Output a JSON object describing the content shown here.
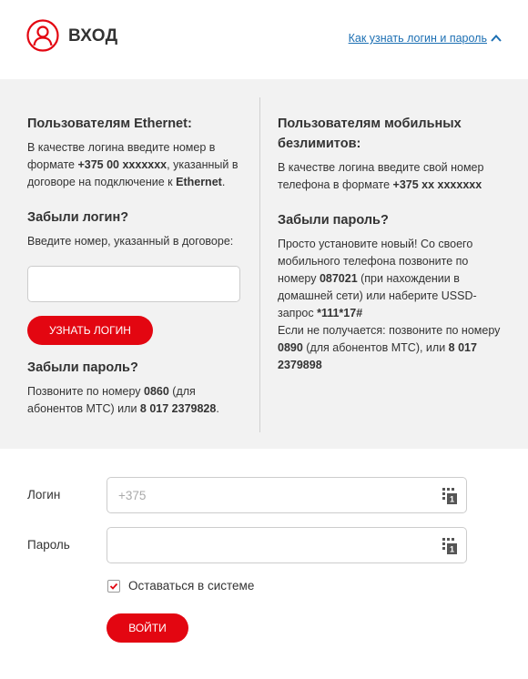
{
  "header": {
    "title": "ВХОД",
    "help_link": "Как узнать логин и пароль"
  },
  "info": {
    "ethernet": {
      "heading": "Пользователям Ethernet:",
      "text_1": "В качестве логина введите номер в формате ",
      "text_bold_1": "+375 00 xxxxxxx",
      "text_2": ", указанный в договоре на подключение к ",
      "text_bold_2": "Ethernet",
      "text_3": "."
    },
    "forgot_login": {
      "heading": "Забыли логин?",
      "text": "Введите номер, указанный в договоре:",
      "button": "Узнать логин"
    },
    "forgot_password_ethernet": {
      "heading": "Забыли пароль?",
      "text_1": "Позвоните по номеру ",
      "phone_1": "0860",
      "text_2": " (для абонентов МТС) или ",
      "phone_2": "8 017 2379828",
      "text_3": "."
    },
    "mobile": {
      "heading": "Пользователям мобильных безлимитов:",
      "text_1": "В качестве логина введите свой номер телефона в формате ",
      "text_bold": "+375 xx xxxxxxx"
    },
    "forgot_password_mobile": {
      "heading": "Забыли пароль?",
      "text_1": "Просто установите новый! Со своего мобильного телефона позвоните по номеру ",
      "phone_1": "087021",
      "text_2": " (при нахождении в домашней сети) или наберите USSD-запрос ",
      "ussd": "*111*17#",
      "text_3": "Если не получается: позвоните по номеру ",
      "phone_2": "0890",
      "text_4": " (для абонентов МТС), или ",
      "phone_3": "8 017 2379898"
    }
  },
  "form": {
    "login_label": "Логин",
    "login_placeholder": "+375",
    "password_label": "Пароль",
    "remember_label": "Оставаться в системе",
    "remember_checked": true,
    "submit": "Войти"
  },
  "colors": {
    "accent": "#e30611",
    "link": "#1c6fb3",
    "panel_bg": "#f2f2f2"
  },
  "icons": {
    "user": "user-circle-icon",
    "chevron": "chevron-up-icon",
    "keypad": "keypad-icon",
    "check": "checkmark-icon"
  }
}
